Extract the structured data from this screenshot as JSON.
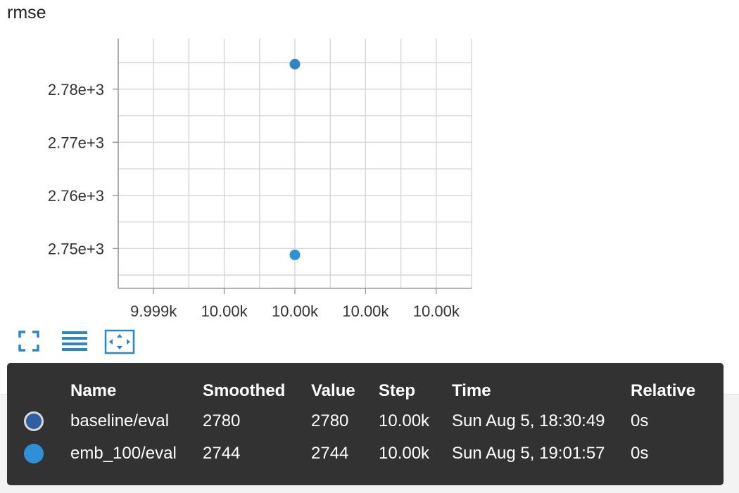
{
  "title": "rmse",
  "chart_data": {
    "type": "scatter",
    "title": "rmse",
    "x_tick_labels": [
      "9.999k",
      "10.00k",
      "10.00k",
      "10.00k",
      "10.00k"
    ],
    "y_tick_labels": [
      "2.78e+3",
      "2.77e+3",
      "2.76e+3",
      "2.75e+3"
    ],
    "y_ticks": [
      2780,
      2770,
      2760,
      2750
    ],
    "ylim": [
      2742.5,
      2789.5
    ],
    "xlim": [
      9999.0,
      10001.0
    ],
    "grid": true,
    "series": [
      {
        "name": "baseline/eval",
        "color": "#3383c9",
        "points": [
          {
            "x": 10000,
            "y": 2784.7
          }
        ]
      },
      {
        "name": "emb_100/eval",
        "color": "#2e90d9",
        "points": [
          {
            "x": 10000,
            "y": 2748.8
          }
        ]
      }
    ]
  },
  "toolbar": {
    "icons": [
      "fit-domain-icon",
      "toggle-log-scale-icon",
      "reset-zoom-icon"
    ],
    "accent": "#2b85c9"
  },
  "tooltip": {
    "headers": {
      "name": "Name",
      "smoothed": "Smoothed",
      "value": "Value",
      "step": "Step",
      "time": "Time",
      "relative": "Relative"
    },
    "rows": [
      {
        "name": "baseline/eval",
        "smoothed": "2780",
        "value": "2780",
        "step": "10.00k",
        "time": "Sun Aug 5, 18:30:49",
        "relative": "0s",
        "color": "#2f5f9e"
      },
      {
        "name": "emb_100/eval",
        "smoothed": "2744",
        "value": "2744",
        "step": "10.00k",
        "time": "Sun Aug 5, 19:01:57",
        "relative": "0s",
        "color": "#2e90d9"
      }
    ]
  }
}
